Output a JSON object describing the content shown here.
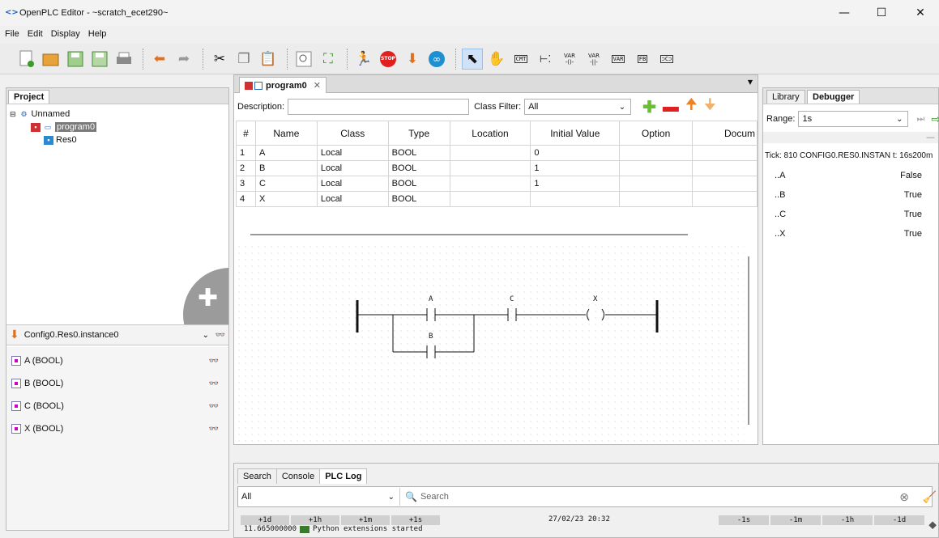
{
  "window": {
    "title": "OpenPLC Editor - ~scratch_ecet290~",
    "minimize": "—",
    "maximize": "☐",
    "close": "✕",
    "app_icon": "<>"
  },
  "menu": [
    "File",
    "Edit",
    "Display",
    "Help"
  ],
  "toolbar": {
    "icons": [
      "new-file",
      "open-file",
      "save",
      "save-as",
      "print",
      "undo",
      "redo",
      "cut",
      "copy",
      "paste",
      "find",
      "fullscreen",
      "run",
      "stop",
      "transfer",
      "debug",
      "pointer",
      "hand",
      "comment",
      "contact-power",
      "coil",
      "contact",
      "variable",
      "function-block",
      "block"
    ],
    "stop_label": "STOP",
    "comment_label": "CMT",
    "var_label": "VAR",
    "fb_label": "FB",
    "var_a": "VAR",
    "var_b": "VAR"
  },
  "project": {
    "title": "Project",
    "root": "Unnamed",
    "program": "program0",
    "resource": "Res0"
  },
  "instance": {
    "value": "Config0.Res0.instance0"
  },
  "variables_panel": [
    {
      "label": "A (BOOL)"
    },
    {
      "label": "B (BOOL)"
    },
    {
      "label": "C (BOOL)"
    },
    {
      "label": "X (BOOL)"
    }
  ],
  "editor": {
    "tab": "program0",
    "description_label": "Description:",
    "class_filter_label": "Class Filter:",
    "class_filter_value": "All",
    "columns": [
      "#",
      "Name",
      "Class",
      "Type",
      "Location",
      "Initial Value",
      "Option",
      "Docum"
    ],
    "rows": [
      {
        "n": "1",
        "name": "A",
        "class": "Local",
        "type": "BOOL",
        "location": "",
        "initial": "0",
        "option": "",
        "doc": ""
      },
      {
        "n": "2",
        "name": "B",
        "class": "Local",
        "type": "BOOL",
        "location": "",
        "initial": "1",
        "option": "",
        "doc": ""
      },
      {
        "n": "3",
        "name": "C",
        "class": "Local",
        "type": "BOOL",
        "location": "",
        "initial": "1",
        "option": "",
        "doc": ""
      },
      {
        "n": "4",
        "name": "X",
        "class": "Local",
        "type": "BOOL",
        "location": "",
        "initial": "",
        "option": "",
        "doc": ""
      }
    ],
    "ladder": {
      "contact_a": "A",
      "contact_b": "B",
      "contact_c": "C",
      "coil_x": "X"
    }
  },
  "debugger": {
    "tabs": [
      "Library",
      "Debugger"
    ],
    "range_label": "Range:",
    "range_value": "1s",
    "tick": "Tick: 810  CONFIG0.RES0.INSTAN t: 16s200m",
    "vars": [
      {
        "name": "..A",
        "value": "False"
      },
      {
        "name": "..B",
        "value": "True"
      },
      {
        "name": "..C",
        "value": "True"
      },
      {
        "name": "..X",
        "value": "True"
      }
    ]
  },
  "log": {
    "tabs": [
      "Search",
      "Console",
      "PLC Log"
    ],
    "filter": "All",
    "search_placeholder": "Search",
    "fwd_buttons": [
      "+1d",
      "+1h",
      "+1m",
      "+1s"
    ],
    "timestamp": "27/02/23 20:32",
    "back_buttons": [
      "-1s",
      "-1m",
      "-1h",
      "-1d"
    ],
    "line_time": "11.665000000",
    "line_text": "Python extensions started"
  }
}
